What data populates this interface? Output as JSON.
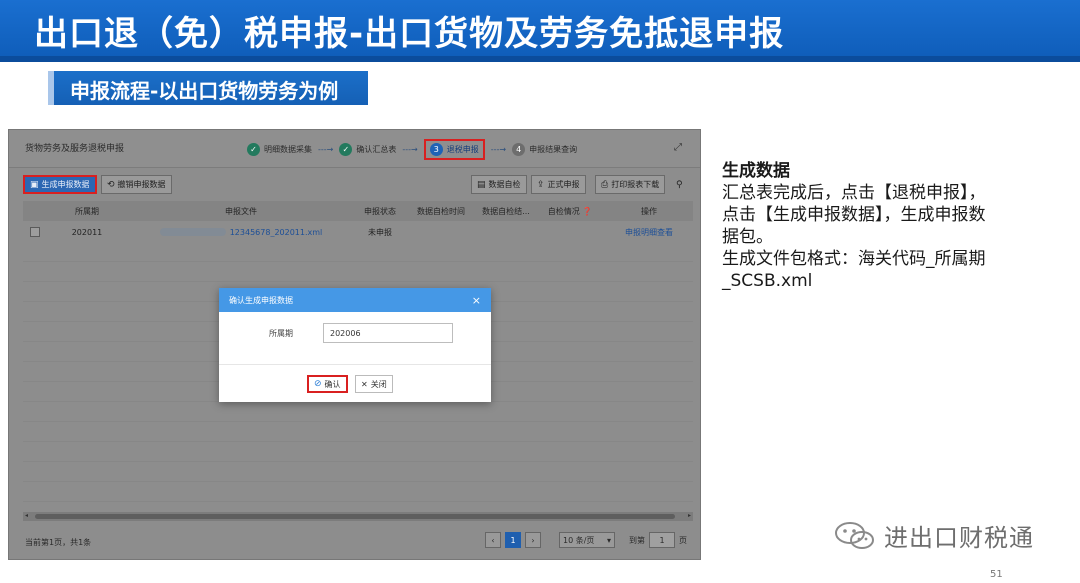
{
  "slide": {
    "title": "出口退（免）税申报-出口货物及劳务免抵退申报",
    "subtitle": "申报流程-以出口货物劳务为例",
    "page_number": "51"
  },
  "app": {
    "panel_title": "货物劳务及服务退税申报",
    "steps": [
      {
        "num": "✓",
        "label": "明细数据采集",
        "state": "done"
      },
      {
        "num": "✓",
        "label": "确认汇总表",
        "state": "done"
      },
      {
        "num": "3",
        "label": "退税申报",
        "state": "current"
      },
      {
        "num": "4",
        "label": "申报结果查询",
        "state": "pending"
      }
    ],
    "toolbar": {
      "generate": "生成申报数据",
      "revoke": "撤销申报数据",
      "data_check": "数据自检",
      "formal_declare": "正式申报",
      "print_download": "打印报表下载"
    },
    "table": {
      "headers": [
        "所属期",
        "申报文件",
        "申报状态",
        "数据自检时间",
        "数据自检结...",
        "自检情况",
        "操作"
      ],
      "rows": [
        {
          "period": "202011",
          "file": "12345678_202011.xml",
          "status": "未申报",
          "check_time": "",
          "check_result": "",
          "check_info": "",
          "action": "申报明细查看"
        }
      ]
    },
    "footer": {
      "count": "当前第1页，共1条",
      "current_page": "1",
      "page_size": "10 条/页",
      "jump_label": "到第",
      "jump_value": "1",
      "page_unit": "页"
    },
    "modal": {
      "title": "确认生成申报数据",
      "field_label": "所属期",
      "field_value": "202006",
      "confirm": "确认",
      "close": "关闭"
    }
  },
  "explain": {
    "heading": "生成数据",
    "line1": "汇总表完成后，点击【退税申报】，",
    "line2": "点击【生成申报数据】，生成申报数",
    "line3": "据包。",
    "line4": "生成文件包格式：海关代码_所属期",
    "line5": "_SCSB.xml"
  },
  "watermark": {
    "text": "进出口财税通"
  }
}
